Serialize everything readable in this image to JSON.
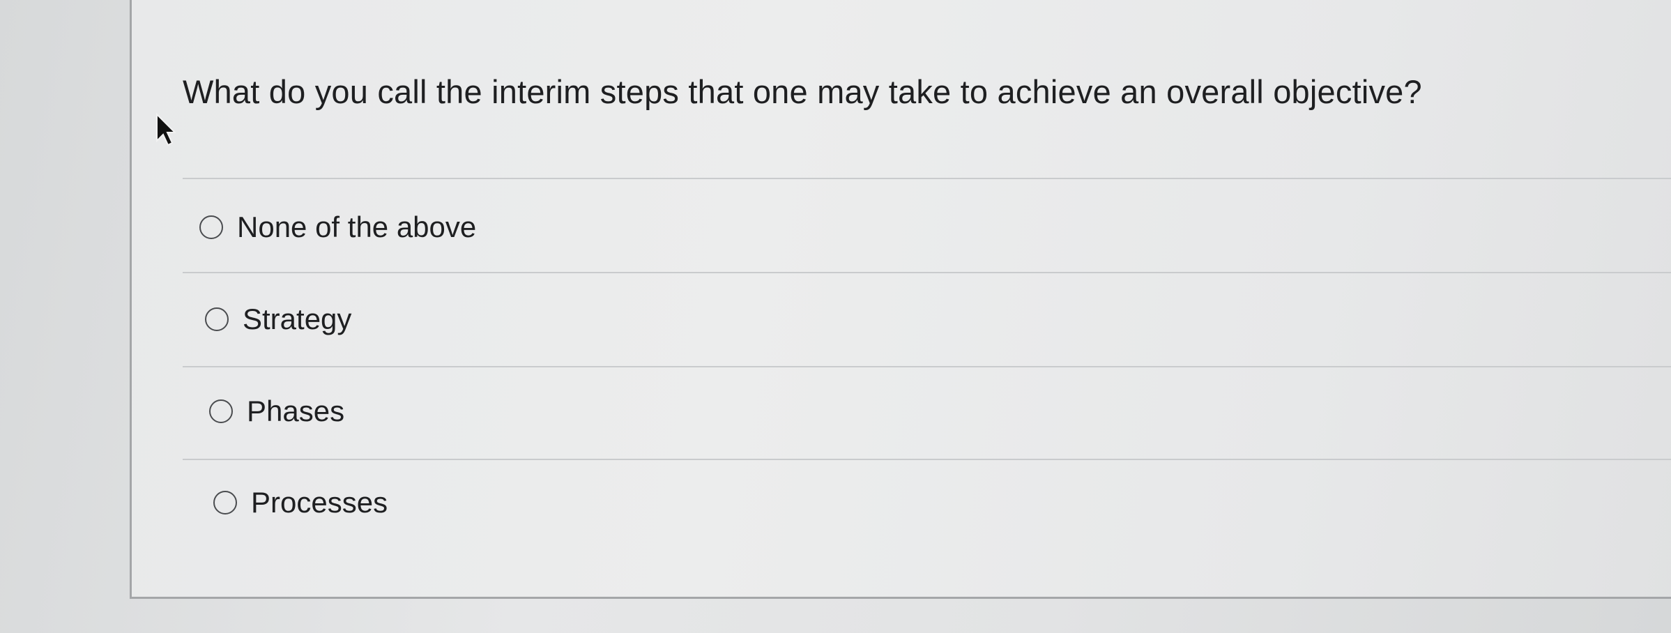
{
  "question": {
    "text": "What do you call the interim steps that one may take to achieve an overall objective?"
  },
  "options": [
    {
      "label": "None of the above",
      "selected": false
    },
    {
      "label": "Strategy",
      "selected": false
    },
    {
      "label": "Phases",
      "selected": false
    },
    {
      "label": "Processes",
      "selected": false
    }
  ],
  "colors": {
    "text": "#1e1f21",
    "radio_border": "#4a4c4f",
    "divider": "#c9cbcd",
    "card_border": "#a4a6a8"
  }
}
